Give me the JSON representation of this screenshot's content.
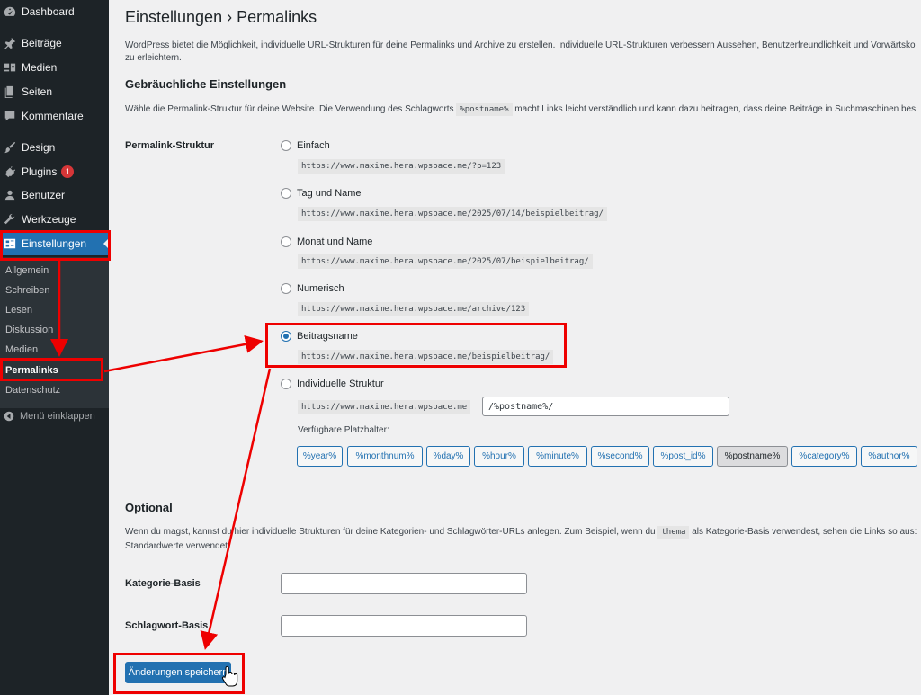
{
  "sidebar": {
    "items": [
      {
        "label": "Dashboard",
        "icon": "dashboard-icon"
      },
      {
        "label": "Beiträge",
        "icon": "pin-icon"
      },
      {
        "label": "Medien",
        "icon": "media-icon"
      },
      {
        "label": "Seiten",
        "icon": "pages-icon"
      },
      {
        "label": "Kommentare",
        "icon": "comment-icon"
      },
      {
        "label": "Design",
        "icon": "brush-icon"
      },
      {
        "label": "Plugins",
        "icon": "plugin-icon",
        "badge": "1"
      },
      {
        "label": "Benutzer",
        "icon": "user-icon"
      },
      {
        "label": "Werkzeuge",
        "icon": "wrench-icon"
      },
      {
        "label": "Einstellungen",
        "icon": "settings-icon"
      }
    ],
    "submenu": [
      "Allgemein",
      "Schreiben",
      "Lesen",
      "Diskussion",
      "Medien",
      "Permalinks",
      "Datenschutz"
    ],
    "collapse_label": "Menü einklappen"
  },
  "page": {
    "title": "Einstellungen › Permalinks",
    "intro_line1": "WordPress bietet die Möglichkeit, individuelle URL-Strukturen für deine Permalinks und Archive zu erstellen. Individuelle URL-Strukturen verbessern Aussehen, Benutzerfreundlichkeit und Vorwärtsko",
    "intro_line2": "zu erleichtern.",
    "common_title": "Gebräuchliche Einstellungen",
    "common_desc_before": "Wähle die Permalink-Struktur für deine Website. Die Verwendung des Schlagworts",
    "common_desc_code": "%postname%",
    "common_desc_after": "macht Links leicht verständlich und kann dazu beitragen, dass deine Beiträge in Suchmaschinen bes",
    "structure_label": "Permalink-Struktur"
  },
  "options": [
    {
      "label": "Einfach",
      "url": "https://www.maxime.hera.wpspace.me/?p=123"
    },
    {
      "label": "Tag und Name",
      "url": "https://www.maxime.hera.wpspace.me/2025/07/14/beispielbeitrag/"
    },
    {
      "label": "Monat und Name",
      "url": "https://www.maxime.hera.wpspace.me/2025/07/beispielbeitrag/"
    },
    {
      "label": "Numerisch",
      "url": "https://www.maxime.hera.wpspace.me/archive/123"
    },
    {
      "label": "Beitragsname",
      "url": "https://www.maxime.hera.wpspace.me/beispielbeitrag/"
    },
    {
      "label": "Individuelle Struktur",
      "url": "https://www.maxime.hera.wpspace.me"
    }
  ],
  "custom": {
    "value": "/%postname%/",
    "placeholders_label": "Verfügbare Platzhalter:",
    "tags": [
      "%year%",
      "%monthnum%",
      "%day%",
      "%hour%",
      "%minute%",
      "%second%",
      "%post_id%",
      "%postname%",
      "%category%",
      "%author%"
    ]
  },
  "optional": {
    "title": "Optional",
    "desc_before": "Wenn du magst, kannst du hier individuelle Strukturen für deine Kategorien- und Schlagwörter-URLs anlegen. Zum Beispiel, wenn du",
    "desc_code": "thema",
    "desc_after": "als Kategorie-Basis verwendest, sehen die Links so aus:",
    "desc_line2": "Standardwerte verwendet.",
    "category_label": "Kategorie-Basis",
    "tag_label": "Schlagwort-Basis",
    "category_value": "",
    "tag_value": ""
  },
  "save_label": "Änderungen speichern",
  "colors": {
    "accent": "#2271b1",
    "annotation": "#e00000",
    "sidebar": "#1d2327"
  }
}
